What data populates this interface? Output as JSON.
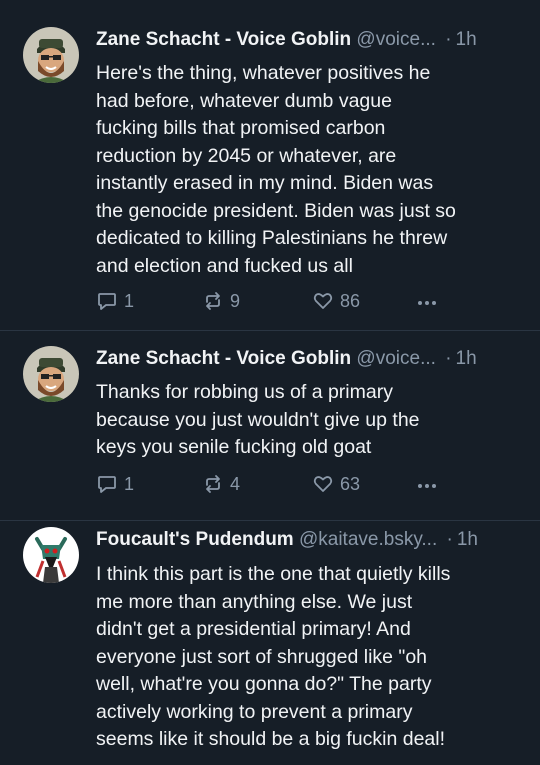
{
  "posts": [
    {
      "author": "Zane Schacht - Voice Goblin",
      "handle": "@voice...",
      "time": "1h",
      "text": "Here's the thing, whatever positives he\nhad before, whatever dumb vague\nfucking bills that promised carbon\nreduction by 2045 or whatever, are\ninstantly erased in my mind. Biden was\nthe genocide president. Biden was just so\ndedicated to killing Palestinians he threw\nand election and fucked us all",
      "replies": "1",
      "reposts": "9",
      "likes": "86"
    },
    {
      "author": "Zane Schacht - Voice Goblin",
      "handle": "@voice...",
      "time": "1h",
      "text": "Thanks for robbing us of a primary\nbecause you just wouldn't give up the\nkeys you senile fucking old goat",
      "replies": "1",
      "reposts": "4",
      "likes": "63"
    },
    {
      "author": "Foucault's Pudendum",
      "handle": "@kaitave.bsky...",
      "time": "1h",
      "text": "I think this part is the one that quietly kills\nme more than anything else. We just\ndidn't get a presidential primary! And\neveryone just sort of shrugged like \"oh\nwell, what're you gonna do?\" The party\nactively working to prevent a primary\nseems like it should be a big fuckin deal!"
    }
  ],
  "icons": {
    "reply": "reply-icon",
    "repost": "repost-icon",
    "like": "heart-icon",
    "more": "more-icon"
  },
  "colors": {
    "background": "#161e27",
    "text": "#f1f3f5",
    "muted": "#8a98a8",
    "divider": "#2a3542"
  }
}
